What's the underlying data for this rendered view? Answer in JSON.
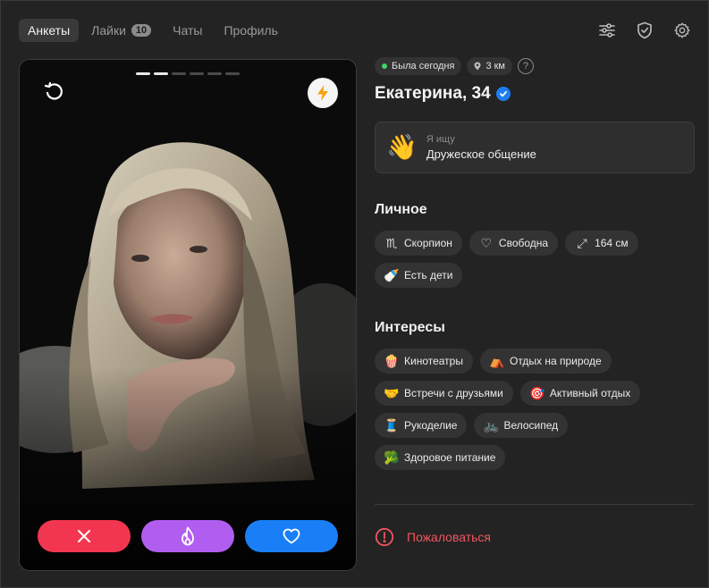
{
  "nav": {
    "tabs": [
      {
        "label": "Анкеты",
        "active": true
      },
      {
        "label": "Лайки",
        "badge": "10"
      },
      {
        "label": "Чаты"
      },
      {
        "label": "Профиль"
      }
    ],
    "icons": [
      "filters-icon",
      "shield-check-icon",
      "settings-gear-icon"
    ]
  },
  "card": {
    "photo_count": 6,
    "current_photo": 2,
    "actions": [
      "dislike",
      "superlike",
      "like"
    ]
  },
  "profile": {
    "status": "Была сегодня",
    "distance": "3 км",
    "help": "?",
    "name": "Екатерина, 34",
    "looking_for": {
      "label": "Я ищу",
      "value": "Дружеское общение",
      "emoji": "👋"
    },
    "personal": {
      "title": "Личное",
      "chips": [
        {
          "icon": "♏",
          "label": "Скорпион"
        },
        {
          "icon": "♡",
          "label": "Свободна"
        },
        {
          "icon": "⤢",
          "label": "164 см"
        },
        {
          "icon": "🍼",
          "label": "Есть дети"
        }
      ]
    },
    "interests": {
      "title": "Интересы",
      "chips": [
        {
          "icon": "🍿",
          "label": "Кинотеатры"
        },
        {
          "icon": "⛺",
          "label": "Отдых на природе"
        },
        {
          "icon": "🤝",
          "label": "Встречи с друзьями"
        },
        {
          "icon": "🎯",
          "label": "Активный отдых"
        },
        {
          "icon": "🧵",
          "label": "Рукоделие"
        },
        {
          "icon": "🚲",
          "label": "Велосипед"
        },
        {
          "icon": "🥦",
          "label": "Здоровое питание"
        }
      ]
    },
    "report": "Пожаловаться"
  },
  "colors": {
    "dislike": "#f2364f",
    "superlike": "#b05df0",
    "like": "#1a7ff7",
    "report": "#f0555e",
    "online": "#3fd36b"
  }
}
